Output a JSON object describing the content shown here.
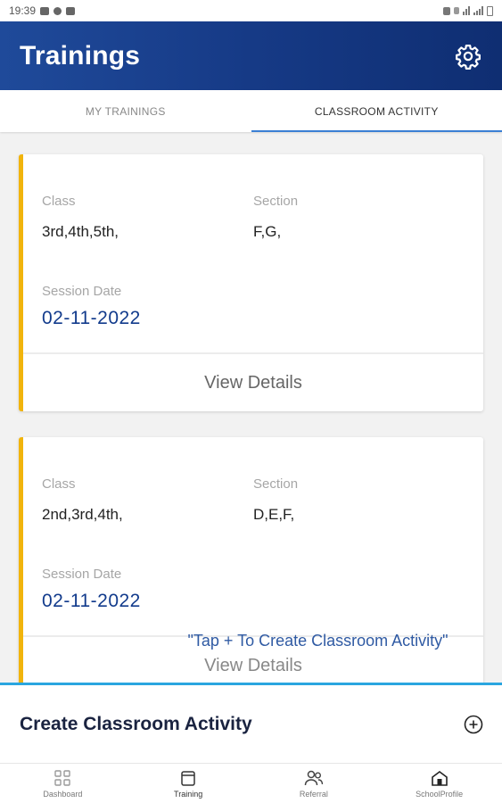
{
  "status_bar": {
    "time": "19:39"
  },
  "app_bar": {
    "title": "Trainings"
  },
  "tabs": [
    {
      "label": "MY TRAININGS",
      "active": false
    },
    {
      "label": "CLASSROOM ACTIVITY",
      "active": true
    }
  ],
  "cards": [
    {
      "class_label": "Class",
      "class_value": "3rd,4th,5th,",
      "section_label": "Section",
      "section_value": "F,G,",
      "date_label": "Session Date",
      "date_value": "02-11-2022",
      "action_label": "View Details"
    },
    {
      "class_label": "Class",
      "class_value": "2nd,3rd,4th,",
      "section_label": "Section",
      "section_value": "D,E,F,",
      "date_label": "Session Date",
      "date_value": "02-11-2022",
      "action_label": "View Details"
    }
  ],
  "hint_text": "\"Tap + To Create Classroom Activity\"",
  "bottom_sheet": {
    "title": "Create Classroom Activity"
  },
  "bottom_nav": [
    {
      "label": "Dashboard",
      "icon": "grid-icon"
    },
    {
      "label": "Training",
      "icon": "training-icon"
    },
    {
      "label": "Referral",
      "icon": "referral-icon"
    },
    {
      "label": "SchoolProfile",
      "icon": "school-icon"
    }
  ],
  "colors": {
    "app_bar": "#163a86",
    "accent_tab": "#3b7fd4",
    "card_border": "#f1b40c",
    "date_text": "#123b8c",
    "sheet_border": "#2aa6e0"
  }
}
